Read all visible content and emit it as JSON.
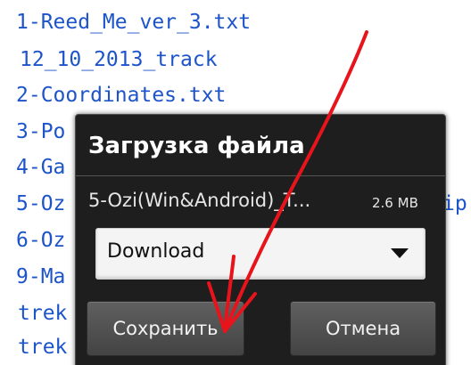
{
  "file_list": {
    "items": [
      "1-Reed_Me_ver_3.txt",
      "12_10_2013_track",
      "2-Coordinates.txt",
      "3-Po",
      "4-Ga",
      "5-Oz",
      "6-Oz",
      "9-Ma",
      "trek",
      "trek"
    ],
    "item5_overflow": "ip"
  },
  "dialog": {
    "title": "Загрузка файла",
    "file_name": "5-Ozi(Win&Android)_T...",
    "file_size": "2.6 MB",
    "folder_select": {
      "value": "Download",
      "icon": "chevron-down-icon"
    },
    "buttons": {
      "save_label": "Сохранить",
      "cancel_label": "Отмена"
    }
  },
  "annotation": {
    "arrow_color": "#e8141c"
  },
  "colors": {
    "link_text": "#1d54c9",
    "dialog_bg": "#1e1e1e",
    "button_bg": "#505050"
  }
}
